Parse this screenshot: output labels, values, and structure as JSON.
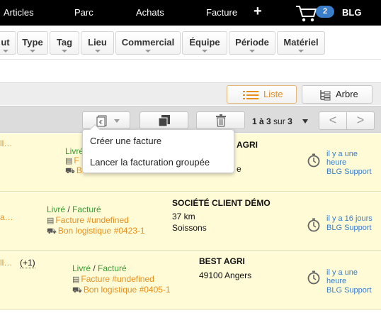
{
  "topnav": {
    "items": [
      "Articles",
      "Parc",
      "Achats",
      "Facture"
    ],
    "plus": "+",
    "cart_count": "2",
    "user": "BLG"
  },
  "filters": [
    "ut",
    "Type",
    "Tag",
    "Lieu",
    "Commercial",
    "Équipe",
    "Période",
    "Matériel"
  ],
  "views": {
    "list": "Liste",
    "tree": "Arbre"
  },
  "pager": {
    "range": "1 à 3",
    "sur": "sur",
    "total": "3",
    "prev": "<",
    "next": ">"
  },
  "dropdown": {
    "items": [
      "Créer une facture",
      "Lancer la facturation groupée"
    ]
  },
  "rows": [
    {
      "cut": "ll…",
      "status_livre": "Livré",
      "status_facture": "F",
      "invoice": "F",
      "delivery": "B",
      "client": "AGRI",
      "city": "e",
      "time": "il y a une\nheure",
      "author": "BLG Support"
    },
    {
      "cut": "a…",
      "status_livre": "Livré",
      "sep": " / ",
      "status_facture": "Facturé",
      "invoice": "Facture #undefined",
      "delivery": "Bon logistique #0423-1",
      "client": "SOCIÉTÉ CLIENT DÉMO",
      "distance": "37 km",
      "city": "Soissons",
      "time": "il y a 16 jours",
      "author": "BLG Support"
    },
    {
      "cut": "ll…",
      "more": "(+1)",
      "status_livre": "Livré",
      "sep": " / ",
      "status_facture": "Facturé",
      "invoice": "Facture #undefined",
      "delivery": "Bon logistique #0405-1",
      "client": "BEST AGRI",
      "city": "49100 Angers",
      "time": "il y a une\nheure",
      "author": "BLG Support"
    }
  ],
  "colors": {
    "accent_orange": "#e8901e",
    "status_green": "#3a9a34",
    "link_blue": "#3a7dc9",
    "row_bg": "#fffbd6"
  }
}
